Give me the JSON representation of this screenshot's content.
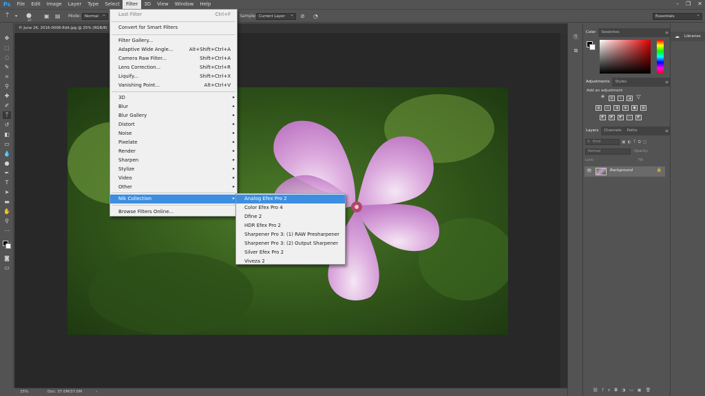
{
  "menubar": {
    "logo": "Ps",
    "items": [
      "File",
      "Edit",
      "Image",
      "Layer",
      "Type",
      "Select",
      "Filter",
      "3D",
      "View",
      "Window",
      "Help"
    ],
    "active_item": "Filter",
    "window_controls": [
      "–",
      "❐",
      "✕"
    ]
  },
  "options_bar": {
    "mode_label": "Mode:",
    "mode_value": "Normal",
    "brush_size": "37",
    "sample_label": "Sample:",
    "sample_value": "Current Layer",
    "workspace": "Essentials"
  },
  "document": {
    "tab_title": "© June 26, 2016-0006-Edit.jpg @ 25% (RGB/8)",
    "zoom": "25%",
    "doc_size": "Doc: 37.0M/37.0M"
  },
  "filter_menu": {
    "items": [
      {
        "label": "Last Filter",
        "shortcut": "Ctrl+F",
        "disabled": true
      },
      {
        "label": "Convert for Smart Filters",
        "shortcut": ""
      },
      {
        "label": "Filter Gallery...",
        "shortcut": ""
      },
      {
        "label": "Adaptive Wide Angle...",
        "shortcut": "Alt+Shift+Ctrl+A"
      },
      {
        "label": "Camera Raw Filter...",
        "shortcut": "Shift+Ctrl+A"
      },
      {
        "label": "Lens Correction...",
        "shortcut": "Shift+Ctrl+R"
      },
      {
        "label": "Liquify...",
        "shortcut": "Shift+Ctrl+X"
      },
      {
        "label": "Vanishing Point...",
        "shortcut": "Alt+Ctrl+V"
      },
      {
        "label": "3D",
        "arrow": "▸"
      },
      {
        "label": "Blur",
        "arrow": "▸"
      },
      {
        "label": "Blur Gallery",
        "arrow": "▸"
      },
      {
        "label": "Distort",
        "arrow": "▸"
      },
      {
        "label": "Noise",
        "arrow": "▸"
      },
      {
        "label": "Pixelate",
        "arrow": "▸"
      },
      {
        "label": "Render",
        "arrow": "▸"
      },
      {
        "label": "Sharpen",
        "arrow": "▸"
      },
      {
        "label": "Stylize",
        "arrow": "▸"
      },
      {
        "label": "Video",
        "arrow": "▸"
      },
      {
        "label": "Other",
        "arrow": "▸"
      },
      {
        "label": "Nik Collection",
        "arrow": "▸",
        "highlighted": true
      },
      {
        "label": "Browse Filters Online..."
      }
    ]
  },
  "nik_submenu": {
    "items": [
      {
        "label": "Analog Efex Pro 2",
        "highlighted": true
      },
      {
        "label": "Color Efex Pro 4"
      },
      {
        "label": "Dfine 2"
      },
      {
        "label": "HDR Efex Pro 2"
      },
      {
        "label": "Sharpener Pro 3: (1) RAW Presharpener"
      },
      {
        "label": "Sharpener Pro 3: (2) Output Sharpener"
      },
      {
        "label": "Silver Efex Pro 2"
      },
      {
        "label": "Viveza 2"
      }
    ]
  },
  "panels": {
    "color_tabs": [
      "Color",
      "Swatches"
    ],
    "adjust_tabs": [
      "Adjustments",
      "Styles"
    ],
    "adjust_hint": "Add an adjustment",
    "layers_tabs": [
      "Layers",
      "Channels",
      "Paths"
    ],
    "layers_kind": "Kind",
    "layers_blend": "Normal",
    "layers_opacity": "Opacity:",
    "layers_lock": "Lock:",
    "layers_fill": "Fill:",
    "layer_name": "Background",
    "libraries_label": "Libraries"
  },
  "colors": {
    "accent": "#3d8ee0",
    "ps_blue": "#31a8ff"
  }
}
